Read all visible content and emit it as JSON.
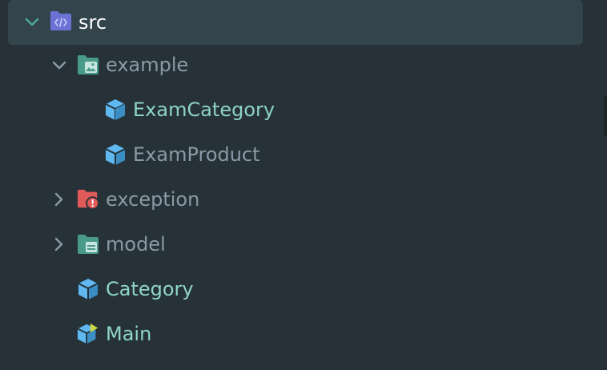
{
  "tree": {
    "items": [
      {
        "label": "src",
        "expanded": true,
        "type": "source-folder",
        "selected": true
      },
      {
        "label": "example",
        "expanded": true,
        "type": "resource-folder"
      },
      {
        "label": "ExamCategory",
        "type": "class"
      },
      {
        "label": "ExamProduct",
        "type": "class"
      },
      {
        "label": "exception",
        "expanded": false,
        "type": "exception-folder"
      },
      {
        "label": "model",
        "expanded": false,
        "type": "model-folder"
      },
      {
        "label": "Category",
        "type": "class"
      },
      {
        "label": "Main",
        "type": "runnable-class"
      }
    ]
  },
  "colors": {
    "background": "#263238",
    "selection": "#33444c",
    "teal_text": "#8fd4c8",
    "muted_text": "#8a9aa6",
    "class_icon": "#5fb8f0",
    "source_folder": "#6a72d6",
    "resource_folder": "#4a9a8a",
    "exception_folder": "#e05a5a",
    "run_marker": "#c7d84a",
    "chevron": "#4aa89a"
  },
  "icons": {
    "expanded": "chevron-down-icon",
    "collapsed": "chevron-right-icon",
    "class": "class-cube-icon",
    "source_folder": "source-folder-icon",
    "resource_folder": "resource-folder-icon",
    "exception_folder": "exception-folder-icon",
    "model_folder": "model-folder-icon"
  }
}
